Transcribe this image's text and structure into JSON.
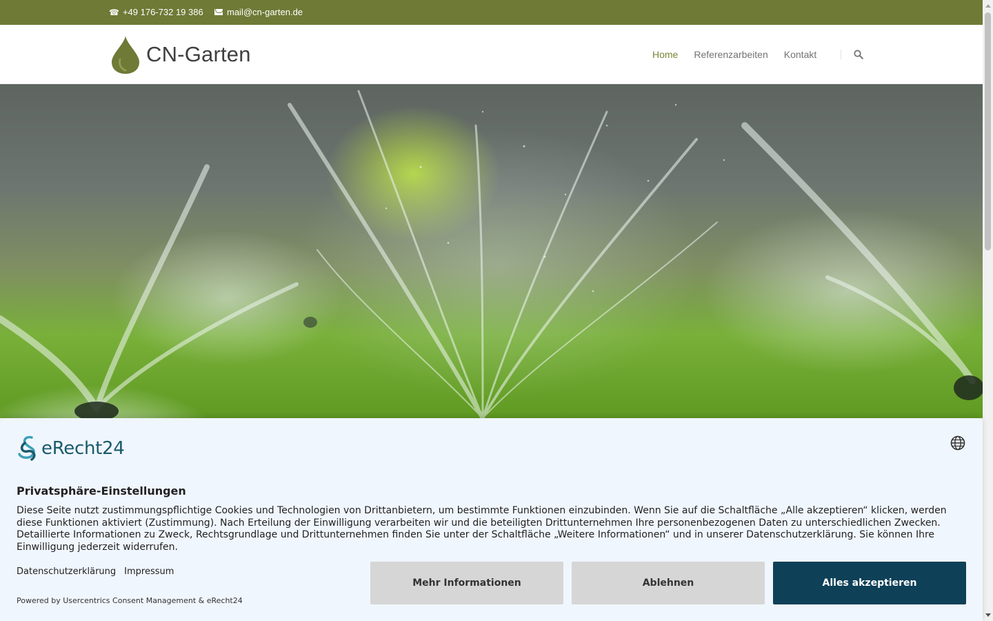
{
  "topbar": {
    "phone": "+49 176-732 19 386",
    "email": "mail@cn-garten.de",
    "phone_icon": "phone-icon",
    "mail_icon": "mail-icon"
  },
  "header": {
    "logo_text": "CN-Garten",
    "nav": [
      {
        "label": "Home",
        "active": true
      },
      {
        "label": "Referenzarbeiten",
        "active": false
      },
      {
        "label": "Kontakt",
        "active": false
      }
    ],
    "search_icon": "search-icon"
  },
  "hero": {
    "image": "garden-sprinklers-photo"
  },
  "consent": {
    "brand": "eRecht24",
    "title": "Privatsphäre-Einstellungen",
    "description": "Diese Seite nutzt zustimmungspflichtige Cookies und Technologien von Drittanbietern, um bestimmte Funktionen einzubinden. Wenn Sie auf die Schaltfläche „Alle akzeptieren“ klicken, werden diese Funktionen aktiviert (Zustimmung). Nach Erteilung der Einwilligung verarbeiten wir und die beteiligten Drittunternehmen Ihre personenbezogenen Daten zu unterschiedlichen Zwecken. Detaillierte Informationen zu Zweck, Rechtsgrundlage und Drittunternehmen finden Sie unter der Schaltfläche „Weitere Informationen“ und in unserer Datenschutzerklärung. Sie können Ihre Einwilligung jederzeit widerrufen.",
    "links": [
      "Datenschutzerklärung",
      "Impressum"
    ],
    "powered_by": "Powered by Usercentrics Consent Management & eRecht24",
    "buttons": {
      "more": "Mehr Informationen",
      "deny": "Ablehnen",
      "accept": "Alles akzeptieren"
    },
    "language_icon": "globe-icon"
  },
  "colors": {
    "topbar": "#6e7a36",
    "nav_active": "#7a8338",
    "accept_button": "#0e4058",
    "consent_bg": "#f0f6fd"
  }
}
